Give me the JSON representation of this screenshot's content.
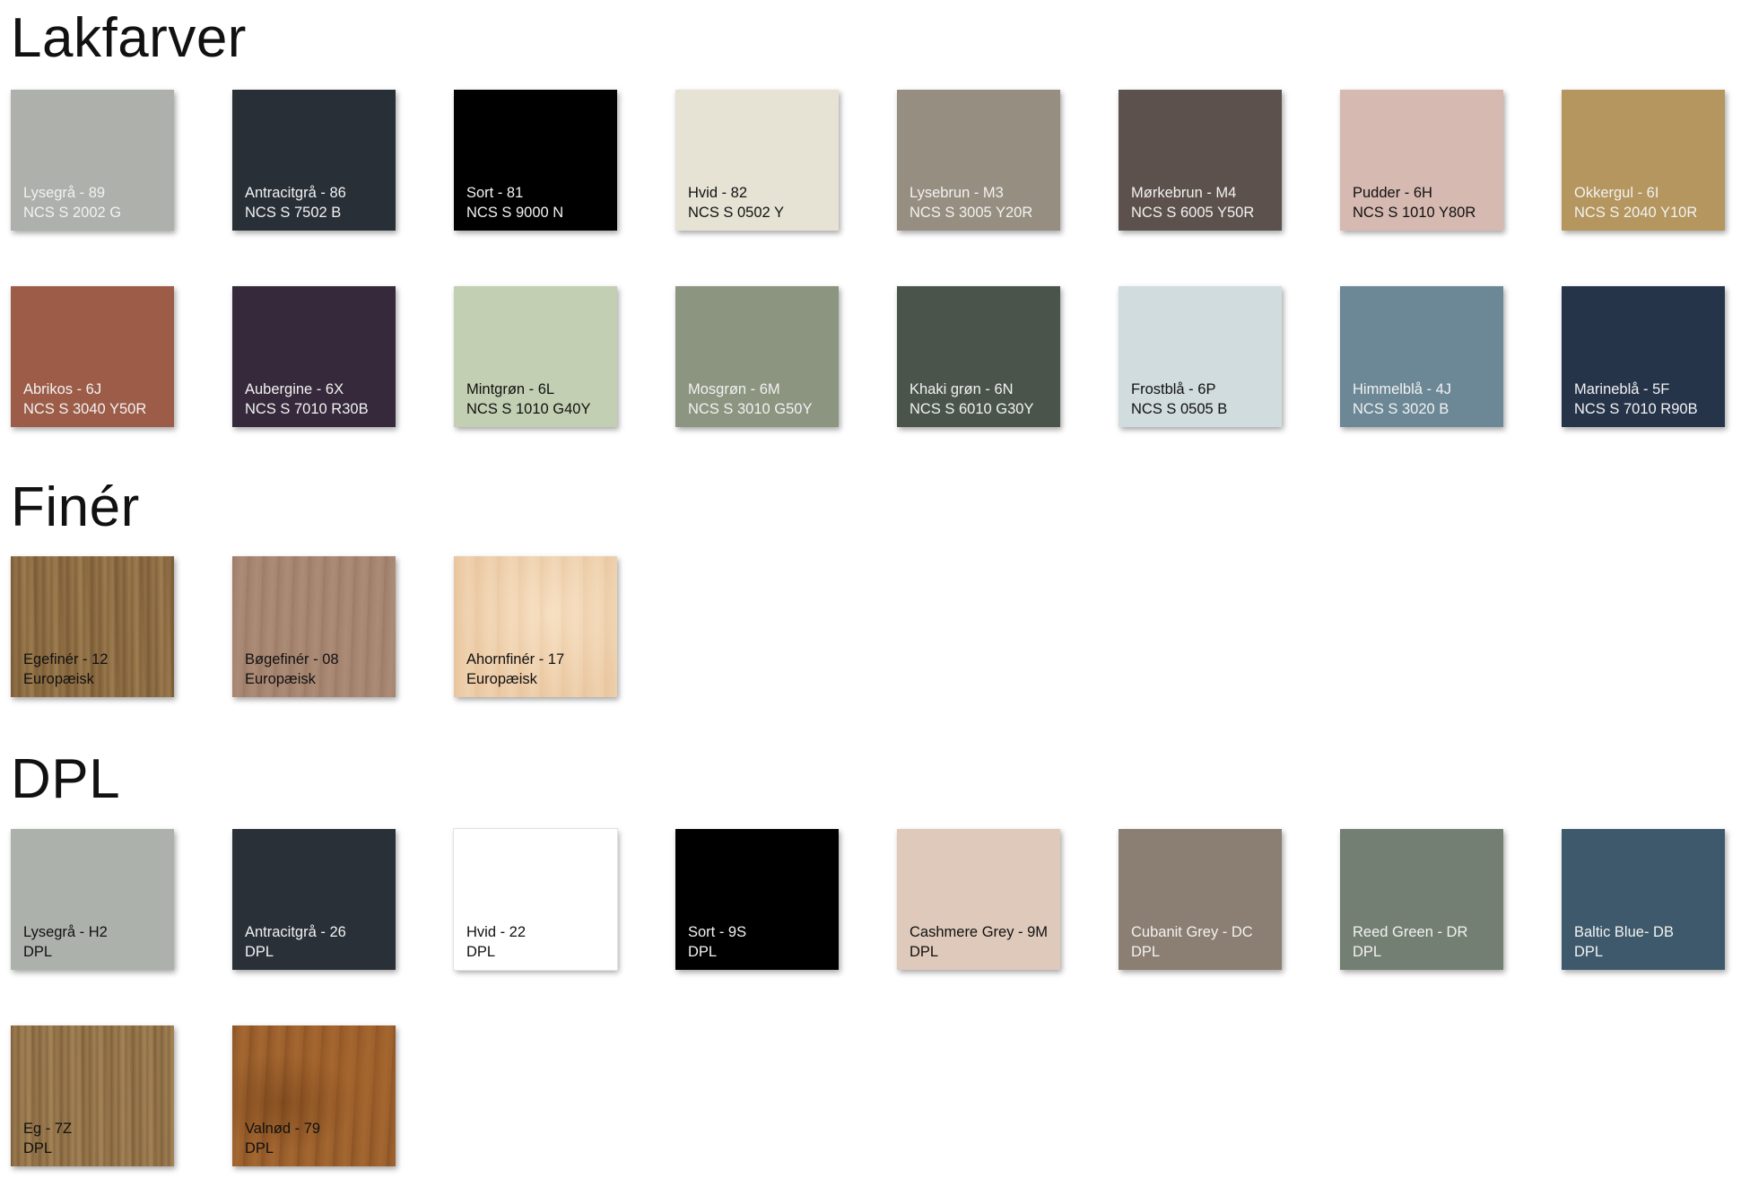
{
  "sections": {
    "lakfarver": {
      "title": "Lakfarver",
      "swatches": [
        {
          "name": "Lysegrå - 89",
          "code": "NCS S 2002 G",
          "color": "#adb0ab",
          "text": "light"
        },
        {
          "name": "Antracitgrå - 86",
          "code": "NCS S 7502 B",
          "color": "#292f37",
          "text": "light"
        },
        {
          "name": "Sort - 81",
          "code": "NCS S 9000 N",
          "color": "#000000",
          "text": "light"
        },
        {
          "name": "Hvid - 82",
          "code": "NCS S 0502 Y",
          "color": "#e6e3d5",
          "text": "dark"
        },
        {
          "name": "Lysebrun - M3",
          "code": "NCS S 3005 Y20R",
          "color": "#968e80",
          "text": "light"
        },
        {
          "name": "Mørkebrun - M4",
          "code": "NCS S 6005 Y50R",
          "color": "#5c514c",
          "text": "light"
        },
        {
          "name": "Pudder - 6H",
          "code": "NCS S 1010 Y80R",
          "color": "#d6b9b1",
          "text": "dark"
        },
        {
          "name": "Okkergul - 6I",
          "code": "NCS S 2040 Y10R",
          "color": "#b4965e",
          "text": "light"
        },
        {
          "name": "Abrikos - 6J",
          "code": "NCS S 3040 Y50R",
          "color": "#9c5c48",
          "text": "light"
        },
        {
          "name": "Aubergine - 6X",
          "code": "NCS S 7010 R30B",
          "color": "#35293b",
          "text": "light"
        },
        {
          "name": "Mintgrøn - 6L",
          "code": "NCS S 1010 G40Y",
          "color": "#c3cfb3",
          "text": "dark"
        },
        {
          "name": "Mosgrøn - 6M",
          "code": "NCS S 3010 G50Y",
          "color": "#8c9580",
          "text": "light"
        },
        {
          "name": "Khaki grøn - 6N",
          "code": "NCS S 6010 G30Y",
          "color": "#4a544b",
          "text": "light"
        },
        {
          "name": "Frostblå - 6P",
          "code": "NCS S 0505 B",
          "color": "#d1dcdf",
          "text": "dark"
        },
        {
          "name": "Himmelblå - 4J",
          "code": "NCS S 3020 B",
          "color": "#6c8795",
          "text": "light"
        },
        {
          "name": "Marineblå - 5F",
          "code": "NCS S 7010 R90B",
          "color": "#26344a",
          "text": "light"
        }
      ]
    },
    "finer": {
      "title": "Finér",
      "swatches": [
        {
          "name": "Egefinér - 12",
          "code": "Europæisk",
          "texture": "wood-eg",
          "text": "dark"
        },
        {
          "name": "Bøgefinér - 08",
          "code": "Europæisk",
          "texture": "wood-boeg",
          "text": "dark"
        },
        {
          "name": "Ahornfinér - 17",
          "code": "Europæisk",
          "texture": "wood-ahorn",
          "text": "dark"
        }
      ]
    },
    "dpl": {
      "title": "DPL",
      "swatches": [
        {
          "name": "Lysegrå - H2",
          "code": "DPL",
          "color": "#adb1ab",
          "text": "dark"
        },
        {
          "name": "Antracitgrå - 26",
          "code": "DPL",
          "color": "#2a3038",
          "text": "light"
        },
        {
          "name": "Hvid - 22",
          "code": "DPL",
          "color": "#ffffff",
          "text": "dark"
        },
        {
          "name": "Sort - 9S",
          "code": "DPL",
          "color": "#000000",
          "text": "light"
        },
        {
          "name": "Cashmere Grey - 9M",
          "code": "DPL",
          "color": "#dec9bb",
          "text": "dark"
        },
        {
          "name": "Cubanit Grey - DC",
          "code": "DPL",
          "color": "#8b7e72",
          "text": "light"
        },
        {
          "name": "Reed Green - DR",
          "code": "DPL",
          "color": "#737f72",
          "text": "light"
        },
        {
          "name": "Baltic Blue- DB",
          "code": "DPL",
          "color": "#3d596b",
          "text": "light"
        },
        {
          "name": "Eg - 7Z",
          "code": "DPL",
          "texture": "wood-eg-dpl",
          "text": "dark"
        },
        {
          "name": "Valnød - 79",
          "code": "DPL",
          "texture": "wood-valnoed",
          "text": "dark"
        }
      ]
    }
  }
}
